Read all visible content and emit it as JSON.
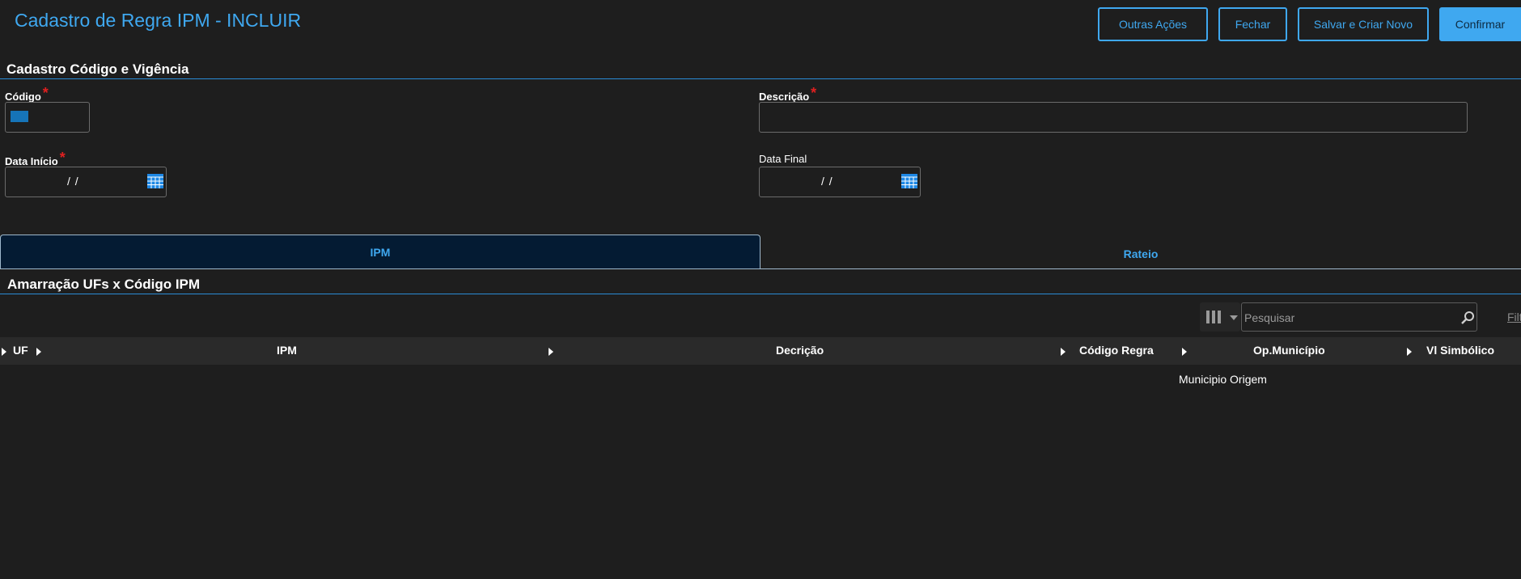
{
  "header": {
    "title": "Cadastro de Regra IPM - INCLUIR",
    "buttons": {
      "outras_acoes": "Outras Ações",
      "fechar": "Fechar",
      "salvar_criar_novo": "Salvar e Criar Novo",
      "confirmar": "Confirmar"
    }
  },
  "section_codigo": {
    "title": "Cadastro Código e Vigência",
    "codigo_label": "Código",
    "descricao_label": "Descrição",
    "data_inicio_label": "Data Início",
    "data_final_label": "Data Final",
    "required_mark": "*",
    "data_inicio_value": "/ /",
    "data_final_value": "/ /"
  },
  "tabs": [
    {
      "label": "IPM",
      "active": true
    },
    {
      "label": "Rateio",
      "active": false
    }
  ],
  "section_amarracao": {
    "title": "Amarração UFs x Código IPM",
    "search_placeholder": "Pesquisar",
    "filter_link": "Filt"
  },
  "grid": {
    "columns": [
      "UF",
      "IPM",
      "Decrição",
      "Código Regra",
      "Op.Município",
      "Vl Simbólico"
    ],
    "subheader": "Municipio Origem"
  },
  "colors": {
    "accent": "#3fa8f0",
    "background": "#1e1e1e",
    "required": "#e02020",
    "active_tab_bg": "#041b33"
  },
  "icons": [
    "calendar-icon",
    "columns-icon",
    "chevron-down-icon",
    "search-icon",
    "sort-arrow-icon"
  ]
}
